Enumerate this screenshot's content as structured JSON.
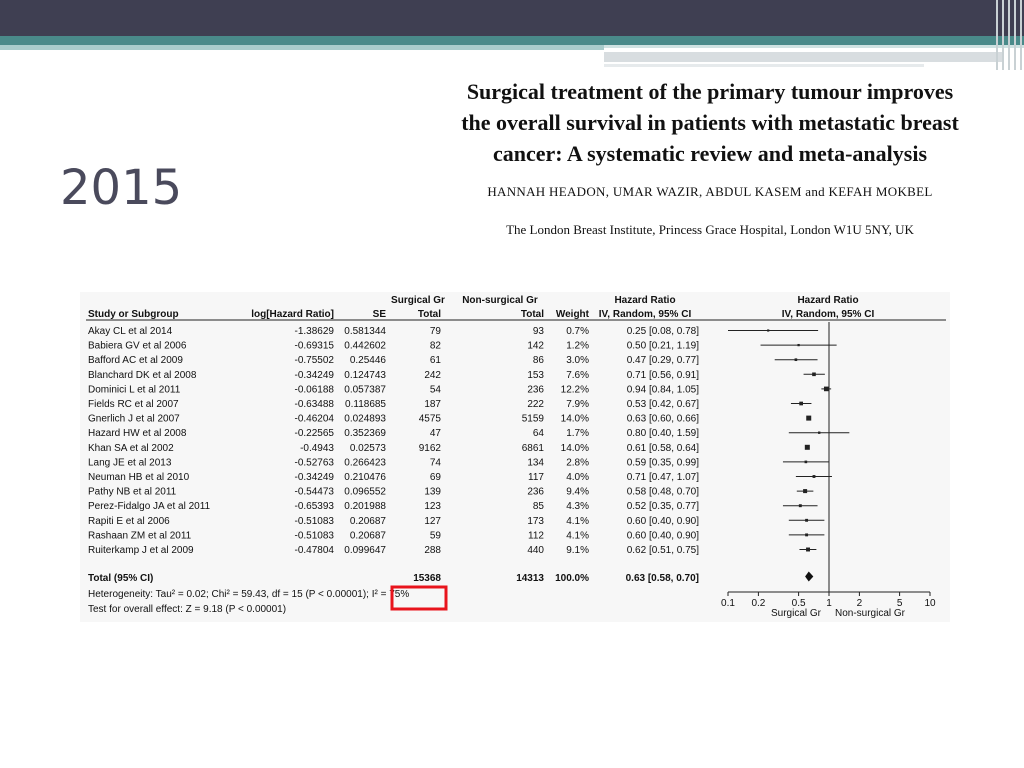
{
  "slide": {
    "year": "2015"
  },
  "paper": {
    "title_lines": [
      "Surgical treatment of the primary tumour improves",
      "the overall survival in patients with metastatic breast",
      "cancer: A systematic review and meta-analysis"
    ],
    "authors": "HANNAH HEADON, UMAR WAZIR, ABDUL KASEM and KEFAH MOKBEL",
    "affiliation": "The London Breast Institute, Princess Grace Hospital, London W1U 5NY, UK"
  },
  "forest": {
    "group_header_1": "Surgical Gr",
    "group_header_2": "Non-surgical Gr",
    "group_header_3": "Hazard Ratio",
    "group_header_4": "Hazard Ratio",
    "col_study": "Study or Subgroup",
    "col_loghr": "log[Hazard Ratio]",
    "col_se": "SE",
    "col_total1": "Total",
    "col_total2": "Total",
    "col_weight": "Weight",
    "col_ci": "IV, Random, 95% CI",
    "col_plot_ci": "IV, Random, 95% CI",
    "total_label": "Total (95% CI)",
    "total_n1": "15368",
    "total_n2": "14313",
    "total_weight": "100.0%",
    "total_ci": "0.63 [0.58, 0.70]",
    "heterogeneity": "Heterogeneity: Tau² = 0.02; Chi² = 59.43, df = 15 (P < 0.00001); I² = 75%",
    "overall_effect": "Test for overall effect: Z = 9.18 (P < 0.00001)",
    "axis_ticks": [
      "0.1",
      "0.2",
      "0.5",
      "1",
      "2",
      "5",
      "10"
    ],
    "axis_left_label": "Surgical Gr",
    "axis_right_label": "Non-surgical Gr",
    "highlight_color": "#e8141c"
  },
  "chart_data": {
    "type": "forest",
    "xscale": "log",
    "xlim": [
      0.1,
      10
    ],
    "studies": [
      {
        "study": "Akay CL et al 2014",
        "loghr": "-1.38629",
        "se": "0.581344",
        "n1": "79",
        "n2": "93",
        "weight": "0.7%",
        "ci": "0.25 [0.08, 0.78]",
        "hr": 0.25,
        "lo": 0.08,
        "hi": 0.78
      },
      {
        "study": "Babiera GV et al 2006",
        "loghr": "-0.69315",
        "se": "0.442602",
        "n1": "82",
        "n2": "142",
        "weight": "1.2%",
        "ci": "0.50 [0.21, 1.19]",
        "hr": 0.5,
        "lo": 0.21,
        "hi": 1.19
      },
      {
        "study": "Bafford AC et al 2009",
        "loghr": "-0.75502",
        "se": "0.25446",
        "n1": "61",
        "n2": "86",
        "weight": "3.0%",
        "ci": "0.47 [0.29, 0.77]",
        "hr": 0.47,
        "lo": 0.29,
        "hi": 0.77
      },
      {
        "study": "Blanchard DK et al 2008",
        "loghr": "-0.34249",
        "se": "0.124743",
        "n1": "242",
        "n2": "153",
        "weight": "7.6%",
        "ci": "0.71 [0.56, 0.91]",
        "hr": 0.71,
        "lo": 0.56,
        "hi": 0.91
      },
      {
        "study": "Dominici L et al 2011",
        "loghr": "-0.06188",
        "se": "0.057387",
        "n1": "54",
        "n2": "236",
        "weight": "12.2%",
        "ci": "0.94 [0.84, 1.05]",
        "hr": 0.94,
        "lo": 0.84,
        "hi": 1.05
      },
      {
        "study": "Fields RC et al 2007",
        "loghr": "-0.63488",
        "se": "0.118685",
        "n1": "187",
        "n2": "222",
        "weight": "7.9%",
        "ci": "0.53 [0.42, 0.67]",
        "hr": 0.53,
        "lo": 0.42,
        "hi": 0.67
      },
      {
        "study": "Gnerlich J et al 2007",
        "loghr": "-0.46204",
        "se": "0.024893",
        "n1": "4575",
        "n2": "5159",
        "weight": "14.0%",
        "ci": "0.63 [0.60, 0.66]",
        "hr": 0.63,
        "lo": 0.6,
        "hi": 0.66
      },
      {
        "study": "Hazard HW et al 2008",
        "loghr": "-0.22565",
        "se": "0.352369",
        "n1": "47",
        "n2": "64",
        "weight": "1.7%",
        "ci": "0.80 [0.40, 1.59]",
        "hr": 0.8,
        "lo": 0.4,
        "hi": 1.59
      },
      {
        "study": "Khan SA et al 2002",
        "loghr": "-0.4943",
        "se": "0.02573",
        "n1": "9162",
        "n2": "6861",
        "weight": "14.0%",
        "ci": "0.61 [0.58, 0.64]",
        "hr": 0.61,
        "lo": 0.58,
        "hi": 0.64
      },
      {
        "study": "Lang JE et al 2013",
        "loghr": "-0.52763",
        "se": "0.266423",
        "n1": "74",
        "n2": "134",
        "weight": "2.8%",
        "ci": "0.59 [0.35, 0.99]",
        "hr": 0.59,
        "lo": 0.35,
        "hi": 0.99
      },
      {
        "study": "Neuman HB et al 2010",
        "loghr": "-0.34249",
        "se": "0.210476",
        "n1": "69",
        "n2": "117",
        "weight": "4.0%",
        "ci": "0.71 [0.47, 1.07]",
        "hr": 0.71,
        "lo": 0.47,
        "hi": 1.07
      },
      {
        "study": "Pathy NB et al 2011",
        "loghr": "-0.54473",
        "se": "0.096552",
        "n1": "139",
        "n2": "236",
        "weight": "9.4%",
        "ci": "0.58 [0.48, 0.70]",
        "hr": 0.58,
        "lo": 0.48,
        "hi": 0.7
      },
      {
        "study": "Perez-Fidalgo JA et al 2011",
        "loghr": "-0.65393",
        "se": "0.201988",
        "n1": "123",
        "n2": "85",
        "weight": "4.3%",
        "ci": "0.52 [0.35, 0.77]",
        "hr": 0.52,
        "lo": 0.35,
        "hi": 0.77
      },
      {
        "study": "Rapiti E et al 2006",
        "loghr": "-0.51083",
        "se": "0.20687",
        "n1": "127",
        "n2": "173",
        "weight": "4.1%",
        "ci": "0.60 [0.40, 0.90]",
        "hr": 0.6,
        "lo": 0.4,
        "hi": 0.9
      },
      {
        "study": "Rashaan ZM et al 2011",
        "loghr": "-0.51083",
        "se": "0.20687",
        "n1": "59",
        "n2": "112",
        "weight": "4.1%",
        "ci": "0.60 [0.40, 0.90]",
        "hr": 0.6,
        "lo": 0.4,
        "hi": 0.9
      },
      {
        "study": "Ruiterkamp J et al 2009",
        "loghr": "-0.47804",
        "se": "0.099647",
        "n1": "288",
        "n2": "440",
        "weight": "9.1%",
        "ci": "0.62 [0.51, 0.75]",
        "hr": 0.62,
        "lo": 0.51,
        "hi": 0.75
      }
    ],
    "pooled": {
      "hr": 0.63,
      "lo": 0.58,
      "hi": 0.7
    }
  }
}
